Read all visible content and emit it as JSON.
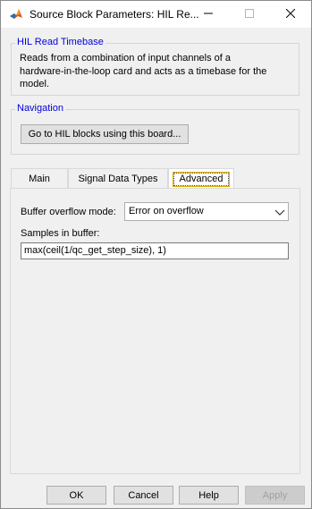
{
  "window": {
    "title": "Source Block Parameters: HIL Re...",
    "controls": [
      "minimize-icon",
      "maximize-icon",
      "close-icon"
    ]
  },
  "description_group": {
    "legend": "HIL Read Timebase",
    "lines": [
      "Reads from a combination of input channels of a",
      "hardware-in-the-loop card and acts as a timebase for the",
      "model."
    ]
  },
  "navigation_group": {
    "legend": "Navigation",
    "button_label": "Go to HIL blocks using this board..."
  },
  "tabs": [
    {
      "label": "Main",
      "active": false
    },
    {
      "label": "Signal Data Types",
      "active": false
    },
    {
      "label": "Advanced",
      "active": true
    }
  ],
  "advanced": {
    "buffer_overflow_label": "Buffer overflow mode:",
    "buffer_overflow_value": "Error on overflow",
    "samples_label": "Samples in buffer:",
    "samples_value": "max(ceil(1/qc_get_step_size), 1)"
  },
  "footer": {
    "ok": "OK",
    "cancel": "Cancel",
    "help": "Help",
    "apply": "Apply"
  },
  "colors": {
    "group_legend": "#0000e0",
    "window_bg": "#f0f0f0",
    "button_bg": "#e1e1e1"
  }
}
